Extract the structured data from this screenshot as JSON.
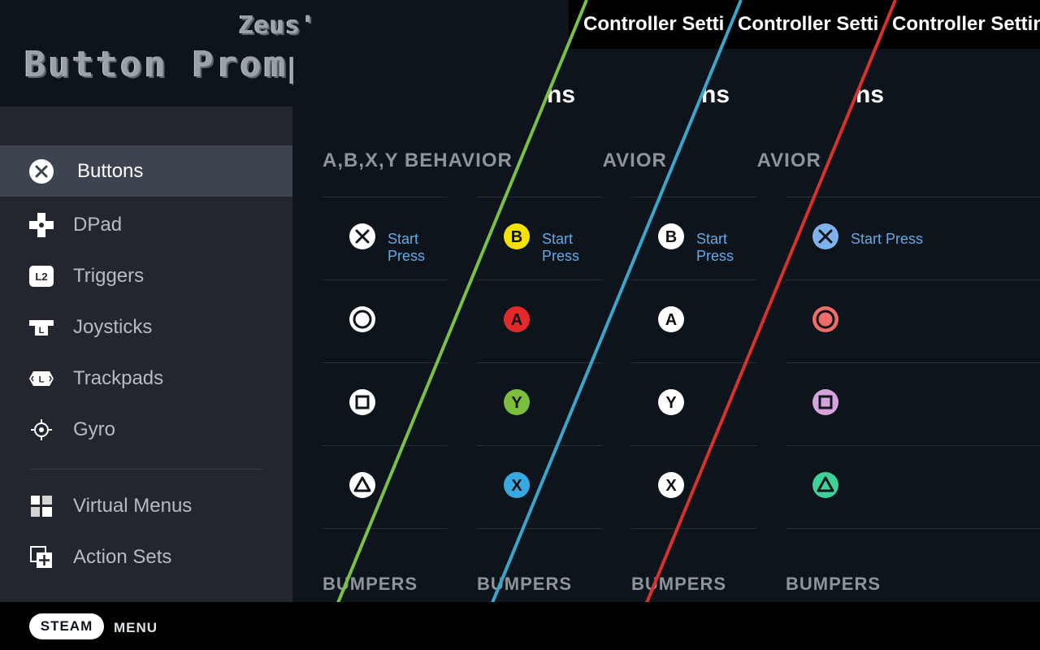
{
  "title": {
    "small": "Zeus'",
    "main": "Button Prompts Galore"
  },
  "banner_title": "Controller Settings",
  "page_heading_fragment": "ns",
  "sidebar": {
    "items": [
      {
        "label": "Buttons",
        "icon": "cross-icon",
        "active": true
      },
      {
        "label": "DPad",
        "icon": "dpad-icon"
      },
      {
        "label": "Triggers",
        "icon": "l2-trigger-icon"
      },
      {
        "label": "Joysticks",
        "icon": "l-joystick-icon"
      },
      {
        "label": "Trackpads",
        "icon": "l-trackpad-icon"
      },
      {
        "label": "Gyro",
        "icon": "gyro-icon"
      },
      {
        "label": "Virtual Menus",
        "icon": "grid-icon"
      },
      {
        "label": "Action Sets",
        "icon": "action-sets-icon"
      }
    ]
  },
  "panes": [
    {
      "section": "A,B,X,Y BEHAVIOR",
      "start_press": "Start Press",
      "bumpers": "BUMPERS",
      "buttons": [
        "cross",
        "circle",
        "square",
        "triangle"
      ]
    },
    {
      "section": "A,B,X,Y BEHAVIOR",
      "start_press": "Start Press",
      "bumpers": "BUMPERS",
      "buttons": [
        "B",
        "A",
        "Y",
        "X"
      ]
    },
    {
      "section": "A,B,X,Y BEHAVIOR",
      "start_press": "Start Press",
      "bumpers": "BUMPERS",
      "buttons": [
        "B",
        "A",
        "Y",
        "X"
      ]
    },
    {
      "section": "A,B,X,Y BEHAVIOR",
      "start_press": "Start Press",
      "bumpers": "BUMPERS",
      "buttons": [
        "cross",
        "circle",
        "square",
        "triangle"
      ]
    }
  ],
  "colors": {
    "line_green": "#7bc143",
    "line_blue": "#3aa6c9",
    "line_red": "#d9312b",
    "xbox_b": "#f5e200",
    "xbox_a": "#e22a2a",
    "xbox_y": "#7bbd3c",
    "xbox_x": "#37a8e0",
    "ps_cross": "#7fb2ec",
    "ps_circle": "#f26b6b",
    "ps_square": "#d6a4dc",
    "ps_triangle": "#3ed29a"
  },
  "bottom_bar": {
    "steam": "STEAM",
    "menu": "MENU"
  }
}
